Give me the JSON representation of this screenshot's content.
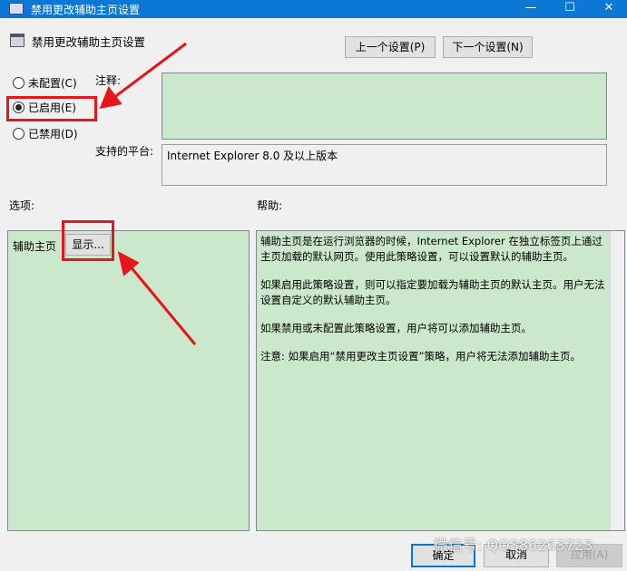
{
  "window": {
    "title": "禁用更改辅助主页设置",
    "minimize": "—",
    "maximize": "☐",
    "close": "✕"
  },
  "header": {
    "title": "禁用更改辅助主页设置",
    "prev_label": "上一个设置(P)",
    "next_label": "下一个设置(N)"
  },
  "radios": [
    {
      "label": "未配置(C)",
      "checked": false
    },
    {
      "label": "已启用(E)",
      "checked": true
    },
    {
      "label": "已禁用(D)",
      "checked": false
    }
  ],
  "comment": {
    "label": "注释:",
    "value": ""
  },
  "platform": {
    "label": "支持的平台:",
    "value": "Internet Explorer 8.0 及以上版本"
  },
  "options": {
    "label": "选项:",
    "item_label": "辅助主页",
    "show_button": "显示..."
  },
  "help": {
    "label": "帮助:",
    "paragraphs": [
      "辅助主页是在运行浏览器的时候，Internet Explorer 在独立标签页上通过主页加载的默认网页。使用此策略设置，可以设置默认的辅助主页。",
      "如果启用此策略设置，则可以指定要加载为辅助主页的默认主页。用户无法设置自定义的默认辅助主页。",
      "如果禁用或未配置此策略设置，用户将可以添加辅助主页。",
      "注意: 如果启用“禁用更改主页设置”策略，用户将无法添加辅助主页。"
    ]
  },
  "footer": {
    "ok": "确定",
    "cancel": "取消",
    "apply": "应用(A)"
  },
  "watermark": "微信号: QQ386263723",
  "colors": {
    "titlebar": "#0a78d4",
    "panel_green": "#cce8cc",
    "annotation_red": "#e8141c"
  }
}
